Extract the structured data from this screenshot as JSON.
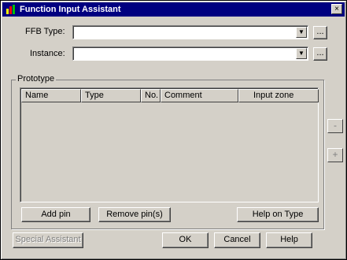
{
  "window": {
    "title": "Function Input Assistant",
    "close_label": "×"
  },
  "fields": {
    "ffb_type": {
      "label": "FFB Type:",
      "value": "",
      "browse_label": "..."
    },
    "instance": {
      "label": "Instance:",
      "value": "",
      "browse_label": "..."
    }
  },
  "prototype": {
    "group_label": "Prototype",
    "columns": [
      "Name",
      "Type",
      "No.",
      "Comment",
      "Input zone"
    ],
    "rows": []
  },
  "side_buttons": {
    "minus": "-",
    "plus": "+"
  },
  "group_buttons": {
    "add_pin": "Add pin",
    "remove_pins": "Remove pin(s)",
    "help_on_type": "Help on Type"
  },
  "footer": {
    "special_assistant": "Special Assistant",
    "ok": "OK",
    "cancel": "Cancel",
    "help": "Help"
  },
  "colors": {
    "titlebar": "#000080",
    "face": "#d4d0c8"
  },
  "icons": {
    "app": "chart-app-icon",
    "close": "close-icon"
  }
}
